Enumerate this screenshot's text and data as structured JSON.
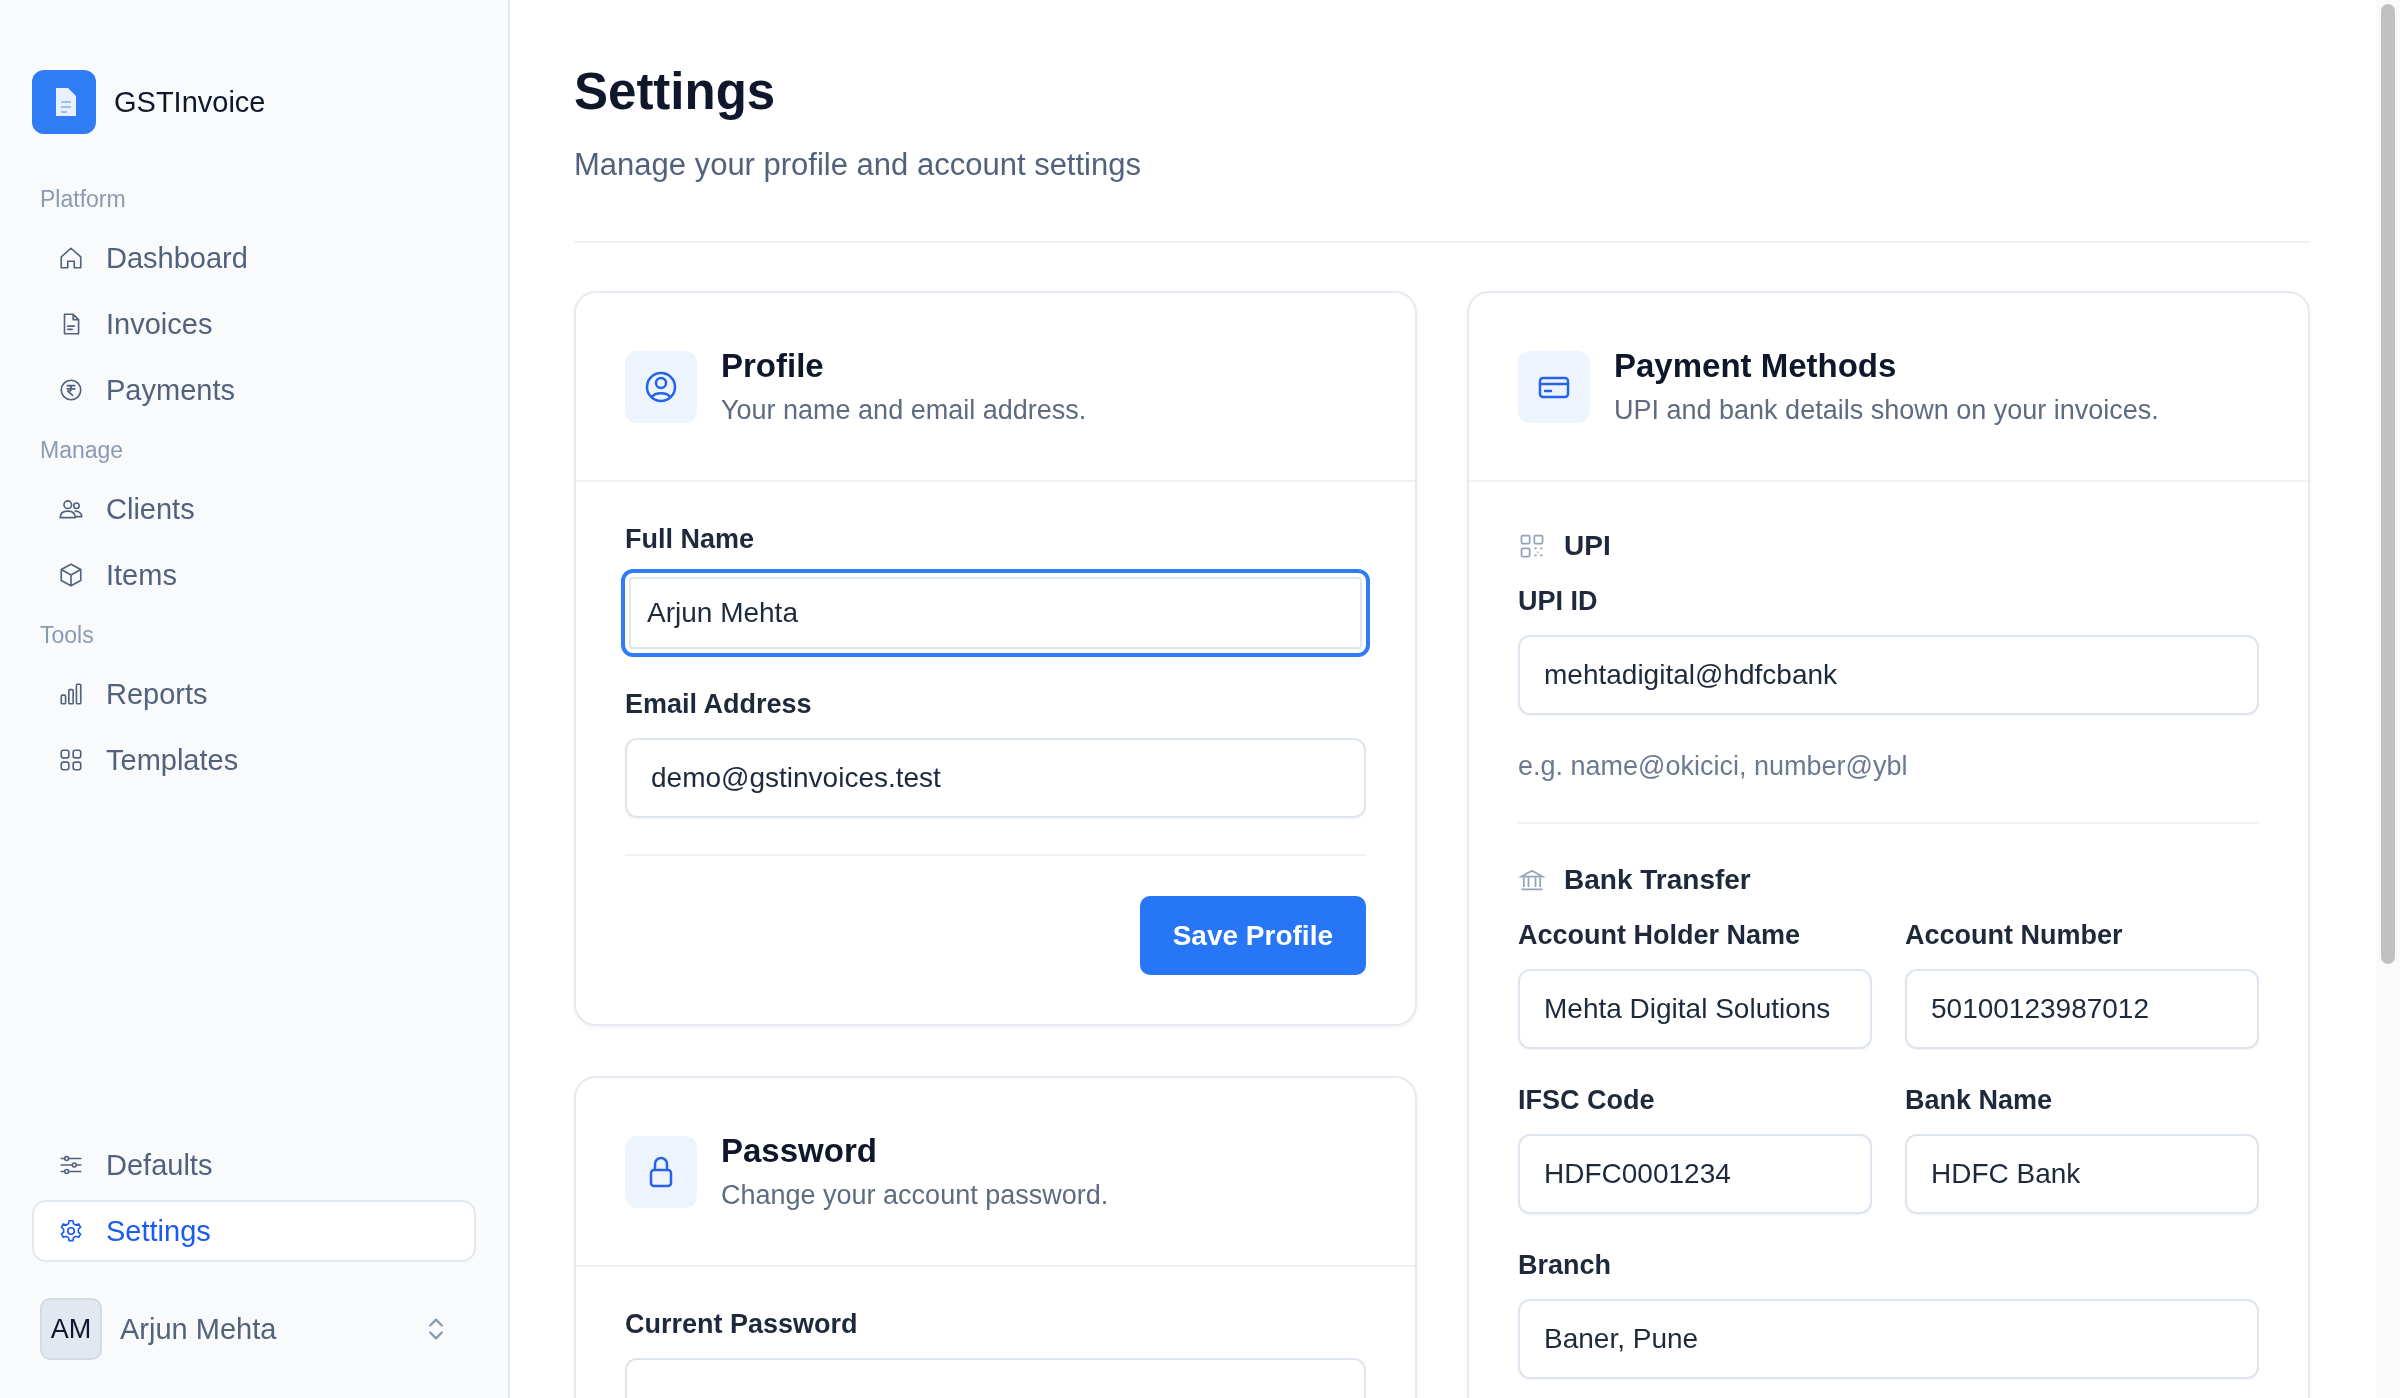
{
  "sidebar": {
    "brand": "GSTInvoice",
    "groups": [
      {
        "label": "Platform",
        "items": [
          {
            "label": "Dashboard",
            "selected": false
          },
          {
            "label": "Invoices",
            "selected": false
          },
          {
            "label": "Payments",
            "selected": false
          }
        ]
      },
      {
        "label": "Manage",
        "items": [
          {
            "label": "Clients",
            "selected": false
          },
          {
            "label": "Items",
            "selected": false
          }
        ]
      },
      {
        "label": "Tools",
        "items": [
          {
            "label": "Reports",
            "selected": false
          },
          {
            "label": "Templates",
            "selected": false
          }
        ]
      }
    ],
    "bottom_items": [
      {
        "label": "Defaults",
        "selected": false
      },
      {
        "label": "Settings",
        "selected": true
      }
    ],
    "user": {
      "initials": "AM",
      "name": "Arjun Mehta"
    }
  },
  "header": {
    "title": "Settings",
    "subtitle": "Manage your profile and account settings"
  },
  "profile_card": {
    "title": "Profile",
    "subtitle": "Your name and email address.",
    "fields": [
      {
        "label": "Full Name",
        "value": "Arjun Mehta",
        "focused": true
      },
      {
        "label": "Email Address",
        "value": "demo@gstinvoices.test",
        "focused": false
      }
    ],
    "button": "Save Profile"
  },
  "password_card": {
    "title": "Password",
    "subtitle": "Change your account password.",
    "fields": [
      {
        "label": "Current Password",
        "focused": false
      }
    ]
  },
  "payment_card": {
    "title": "Payment Methods",
    "subtitle": "UPI and bank details shown on your invoices.",
    "upi": {
      "heading": "UPI",
      "fields": [
        {
          "label": "UPI ID",
          "value": "mehtadigital@hdfcbank",
          "focused": false
        }
      ],
      "hint": "e.g. name@okicici, number@ybl"
    },
    "bank": {
      "heading": "Bank Transfer",
      "fields": [
        {
          "label": "Account Holder Name",
          "value": "Mehta Digital Solutions",
          "focused": false,
          "wide": false
        },
        {
          "label": "Account Number",
          "value": "50100123987012",
          "focused": false,
          "wide": false
        },
        {
          "label": "IFSC Code",
          "value": "HDFC0001234",
          "focused": false,
          "wide": false
        },
        {
          "label": "Bank Name",
          "value": "HDFC Bank",
          "focused": false,
          "wide": false
        },
        {
          "label": "Branch",
          "value": "Baner, Pune",
          "focused": false,
          "wide": true
        }
      ]
    }
  }
}
